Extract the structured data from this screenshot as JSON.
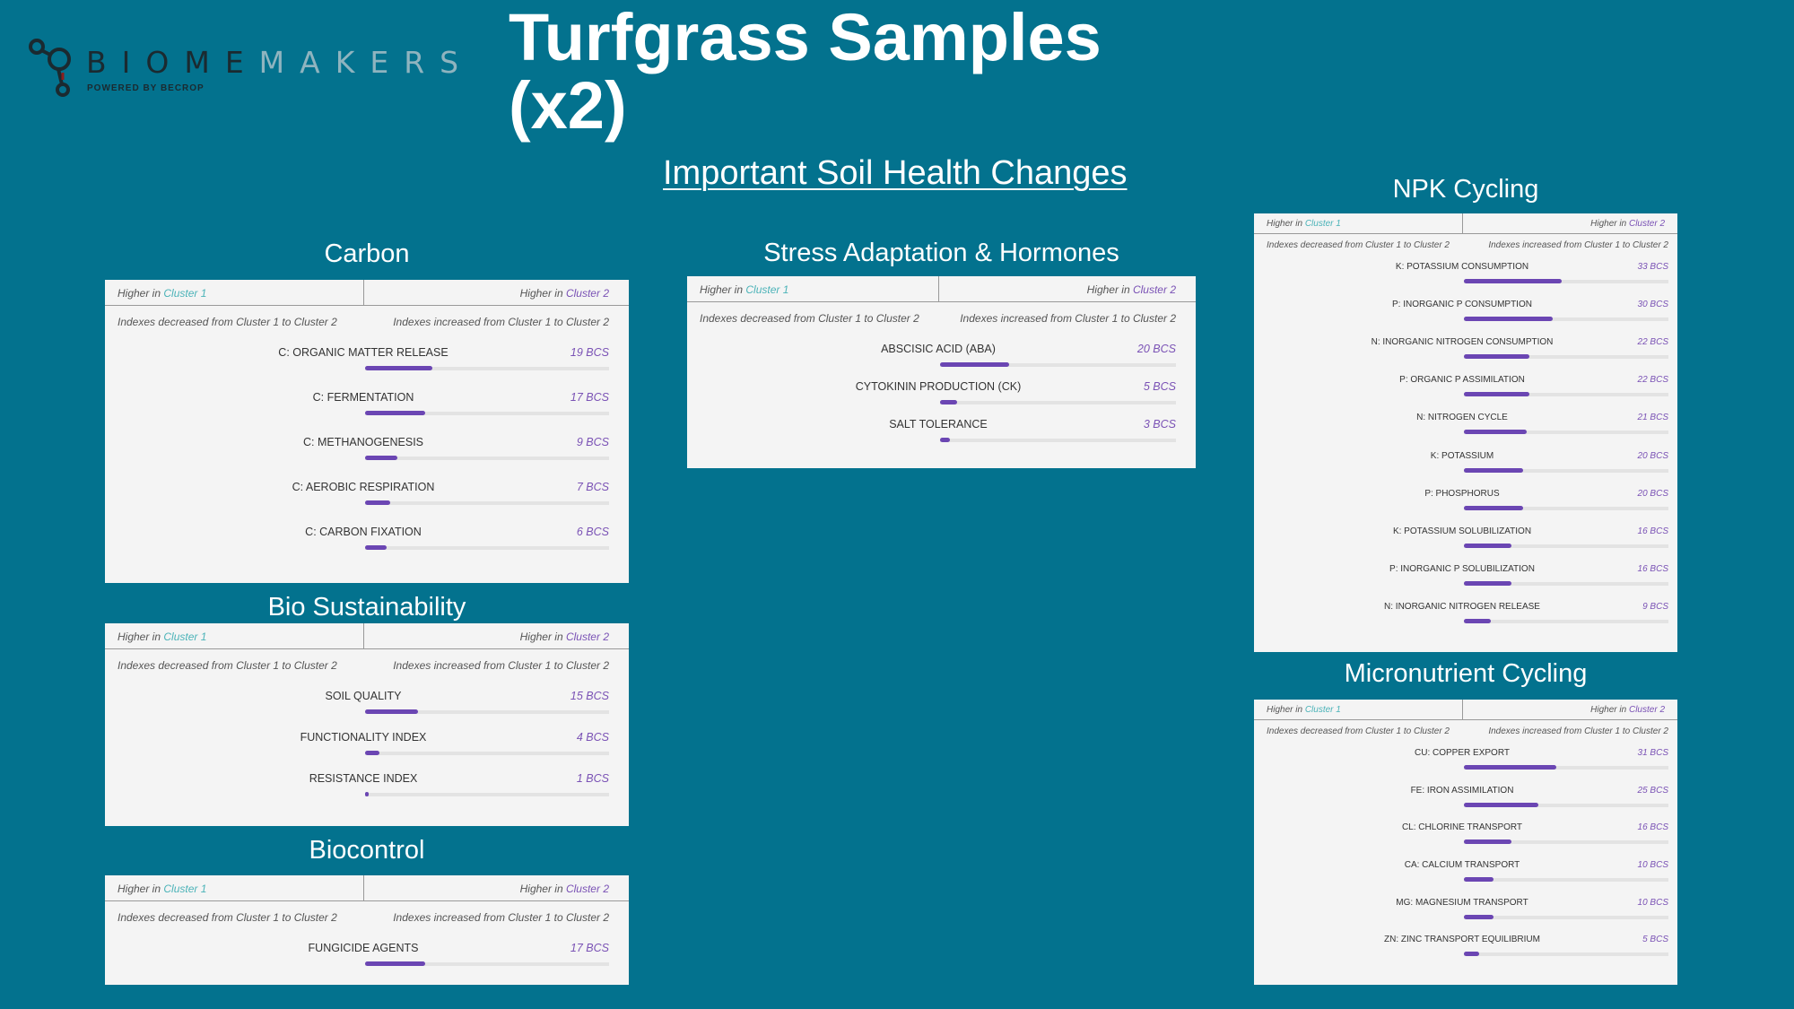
{
  "logo": {
    "text_dark": "BIOME",
    "text_light": "MAKERS",
    "tagline": "POWERED BY BECROP"
  },
  "title": "Turfgrass Samples (x2)",
  "subtitle": "Important Soil Health Changes",
  "colors": {
    "background": "#03728e",
    "cluster1": "#4bb3b8",
    "cluster2": "#7a52b5",
    "bar": "#6b46b3",
    "panel": "#f4f4f4"
  },
  "max_bcs": 33,
  "panels": {
    "carbon": {
      "title": "Carbon",
      "header_left_prefix": "Higher in",
      "header_left_cluster": "Cluster 1",
      "header_right_prefix": "Higher in",
      "header_right_cluster": "Cluster 2",
      "sub_left": "Indexes decreased from Cluster 1 to Cluster 2",
      "sub_right": "Indexes increased from Cluster 1 to Cluster 2",
      "rows": [
        {
          "label": "C: ORGANIC MATTER RELEASE",
          "value": "19 BCS",
          "bcs": 19
        },
        {
          "label": "C: FERMENTATION",
          "value": "17 BCS",
          "bcs": 17
        },
        {
          "label": "C: METHANOGENESIS",
          "value": "9 BCS",
          "bcs": 9
        },
        {
          "label": "C: AEROBIC RESPIRATION",
          "value": "7 BCS",
          "bcs": 7
        },
        {
          "label": "C: CARBON FIXATION",
          "value": "6 BCS",
          "bcs": 6
        }
      ]
    },
    "bio": {
      "title": "Bio Sustainability",
      "header_left_prefix": "Higher in",
      "header_left_cluster": "Cluster 1",
      "header_right_prefix": "Higher in",
      "header_right_cluster": "Cluster 2",
      "sub_left": "Indexes decreased from Cluster 1 to Cluster 2",
      "sub_right": "Indexes increased from Cluster 1 to Cluster 2",
      "rows": [
        {
          "label": "SOIL QUALITY",
          "value": "15 BCS",
          "bcs": 15
        },
        {
          "label": "FUNCTIONALITY INDEX",
          "value": "4 BCS",
          "bcs": 4
        },
        {
          "label": "RESISTANCE INDEX",
          "value": "1 BCS",
          "bcs": 1
        }
      ]
    },
    "biocontrol": {
      "title": "Biocontrol",
      "header_left_prefix": "Higher in",
      "header_left_cluster": "Cluster 1",
      "header_right_prefix": "Higher in",
      "header_right_cluster": "Cluster 2",
      "sub_left": "Indexes decreased from Cluster 1 to Cluster 2",
      "sub_right": "Indexes increased from Cluster 1 to Cluster 2",
      "rows": [
        {
          "label": "FUNGICIDE AGENTS",
          "value": "17 BCS",
          "bcs": 17
        }
      ]
    },
    "stress": {
      "title": "Stress Adaptation & Hormones",
      "header_left_prefix": "Higher in",
      "header_left_cluster": "Cluster 1",
      "header_right_prefix": "Higher in",
      "header_right_cluster": "Cluster 2",
      "sub_left": "Indexes decreased from Cluster 1 to Cluster 2",
      "sub_right": "Indexes increased from Cluster 1 to Cluster 2",
      "rows": [
        {
          "label": "ABSCISIC ACID (ABA)",
          "value": "20 BCS",
          "bcs": 20
        },
        {
          "label": "CYTOKININ PRODUCTION (CK)",
          "value": "5 BCS",
          "bcs": 5
        },
        {
          "label": "SALT TOLERANCE",
          "value": "3 BCS",
          "bcs": 3
        }
      ]
    },
    "npk": {
      "title": "NPK Cycling",
      "header_left_prefix": "Higher in",
      "header_left_cluster": "Cluster 1",
      "header_right_prefix": "Higher in",
      "header_right_cluster": "Cluster 2",
      "sub_left": "Indexes decreased from Cluster 1 to Cluster 2",
      "sub_right": "Indexes increased from Cluster 1 to Cluster 2",
      "rows": [
        {
          "label": "K: POTASSIUM CONSUMPTION",
          "value": "33 BCS",
          "bcs": 33
        },
        {
          "label": "P: INORGANIC P CONSUMPTION",
          "value": "30 BCS",
          "bcs": 30
        },
        {
          "label": "N: INORGANIC NITROGEN CONSUMPTION",
          "value": "22 BCS",
          "bcs": 22
        },
        {
          "label": "P: ORGANIC P ASSIMILATION",
          "value": "22 BCS",
          "bcs": 22
        },
        {
          "label": "N: NITROGEN CYCLE",
          "value": "21 BCS",
          "bcs": 21
        },
        {
          "label": "K: POTASSIUM",
          "value": "20 BCS",
          "bcs": 20
        },
        {
          "label": "P: PHOSPHORUS",
          "value": "20 BCS",
          "bcs": 20
        },
        {
          "label": "K: POTASSIUM SOLUBILIZATION",
          "value": "16 BCS",
          "bcs": 16
        },
        {
          "label": "P: INORGANIC P SOLUBILIZATION",
          "value": "16 BCS",
          "bcs": 16
        },
        {
          "label": "N: INORGANIC NITROGEN RELEASE",
          "value": "9 BCS",
          "bcs": 9
        }
      ]
    },
    "micro": {
      "title": "Micronutrient Cycling",
      "header_left_prefix": "Higher in",
      "header_left_cluster": "Cluster 1",
      "header_right_prefix": "Higher in",
      "header_right_cluster": "Cluster 2",
      "sub_left": "Indexes decreased from Cluster 1 to Cluster 2",
      "sub_right": "Indexes increased from Cluster 1 to Cluster 2",
      "rows": [
        {
          "label": "CU: COPPER EXPORT",
          "value": "31 BCS",
          "bcs": 31
        },
        {
          "label": "FE: IRON ASSIMILATION",
          "value": "25 BCS",
          "bcs": 25
        },
        {
          "label": "CL: CHLORINE TRANSPORT",
          "value": "16 BCS",
          "bcs": 16
        },
        {
          "label": "CA: CALCIUM TRANSPORT",
          "value": "10 BCS",
          "bcs": 10
        },
        {
          "label": "MG: MAGNESIUM TRANSPORT",
          "value": "10 BCS",
          "bcs": 10
        },
        {
          "label": "ZN: ZINC TRANSPORT EQUILIBRIUM",
          "value": "5 BCS",
          "bcs": 5
        }
      ]
    }
  }
}
